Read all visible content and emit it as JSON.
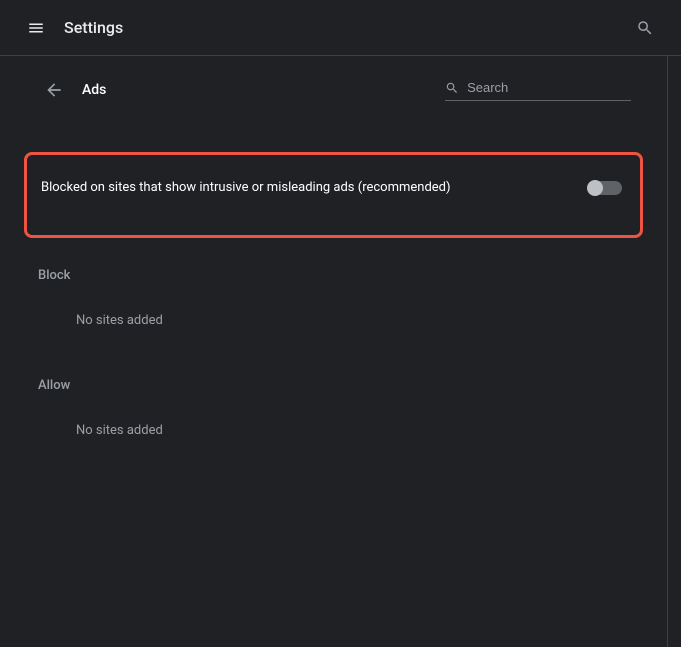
{
  "topbar": {
    "title": "Settings"
  },
  "subheader": {
    "title": "Ads",
    "search_placeholder": "Search"
  },
  "main_toggle": {
    "label": "Blocked on sites that show intrusive or misleading ads (recommended)"
  },
  "sections": {
    "block": {
      "label": "Block",
      "empty": "No sites added"
    },
    "allow": {
      "label": "Allow",
      "empty": "No sites added"
    }
  }
}
